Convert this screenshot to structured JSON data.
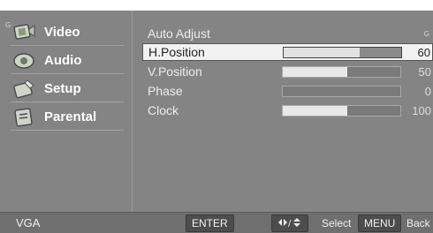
{
  "sidebar": {
    "items": [
      {
        "label": "Video",
        "icon": "video-icon",
        "g": "G"
      },
      {
        "label": "Audio",
        "icon": "audio-icon"
      },
      {
        "label": "Setup",
        "icon": "setup-icon"
      },
      {
        "label": "Parental",
        "icon": "parental-icon"
      }
    ]
  },
  "menu": {
    "header": {
      "label": "Auto Adjust",
      "g": "G"
    },
    "rows": [
      {
        "label": "H.Position",
        "value": "60",
        "level": 0.65,
        "selected": true
      },
      {
        "label": "V.Position",
        "value": "50",
        "level": 0.55,
        "selected": false
      },
      {
        "label": "Phase",
        "value": "0",
        "level": 0.0,
        "selected": false
      },
      {
        "label": "Clock",
        "value": "100",
        "level": 0.55,
        "selected": false
      }
    ]
  },
  "footer": {
    "source": "VGA",
    "enter_label": "ENTER",
    "select_label": "Select",
    "menu_label": "MENU",
    "back_label": "Back",
    "nav_icon": "arrows-icon"
  },
  "colors": {
    "panel": "#848484",
    "footer": "#6f6f6f",
    "selected_row": "#f2f2f2"
  }
}
